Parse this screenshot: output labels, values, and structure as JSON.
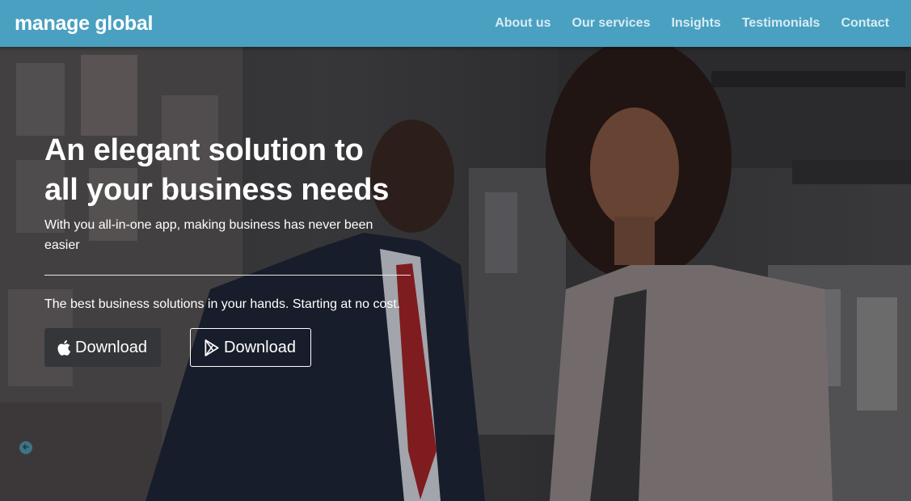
{
  "navbar": {
    "brand": "manage global",
    "links": [
      "About us",
      "Our services",
      "Insights",
      "Testimonials",
      "Contact"
    ]
  },
  "hero": {
    "title_line1": "An elegant solution to",
    "title_line2": "all your business needs",
    "subtitle": "With you all-in-one app, making business has never been easier",
    "tagline": "The best business solutions in your hands. Starting at no cost.",
    "buttons": {
      "apple": {
        "label": "Download",
        "icon": "apple-icon"
      },
      "play": {
        "label": "Download",
        "icon": "google-play-icon"
      }
    }
  },
  "colors": {
    "navbar": "#4aa0c0",
    "nav_link": "#d6ecf4",
    "apple_button": "#34363a"
  }
}
